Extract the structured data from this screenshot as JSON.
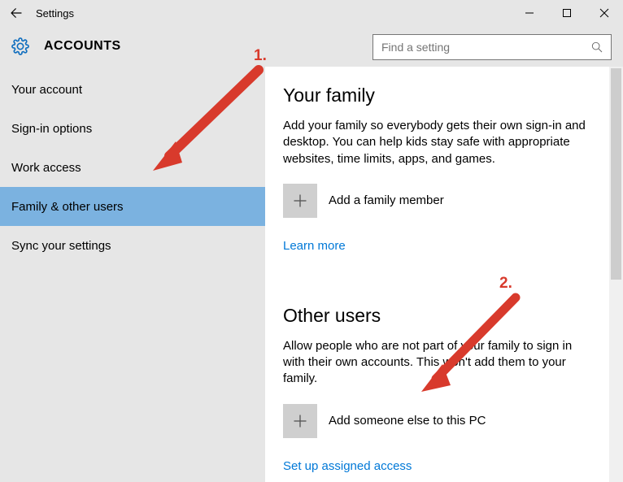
{
  "window": {
    "title": "Settings"
  },
  "header": {
    "category": "ACCOUNTS",
    "search_placeholder": "Find a setting"
  },
  "sidebar": {
    "items": [
      {
        "label": "Your account"
      },
      {
        "label": "Sign-in options"
      },
      {
        "label": "Work access"
      },
      {
        "label": "Family & other users"
      },
      {
        "label": "Sync your settings"
      }
    ],
    "active_index": 3
  },
  "content": {
    "family": {
      "heading": "Your family",
      "description": "Add your family so everybody gets their own sign-in and desktop. You can help kids stay safe with appropriate websites, time limits, apps, and games.",
      "add_label": "Add a family member",
      "learn_more": "Learn more"
    },
    "other": {
      "heading": "Other users",
      "description": "Allow people who are not part of your family to sign in with their own accounts. This won't add them to your family.",
      "add_label": "Add someone else to this PC",
      "assigned_access": "Set up assigned access"
    }
  },
  "annotations": {
    "one": "1.",
    "two": "2."
  }
}
